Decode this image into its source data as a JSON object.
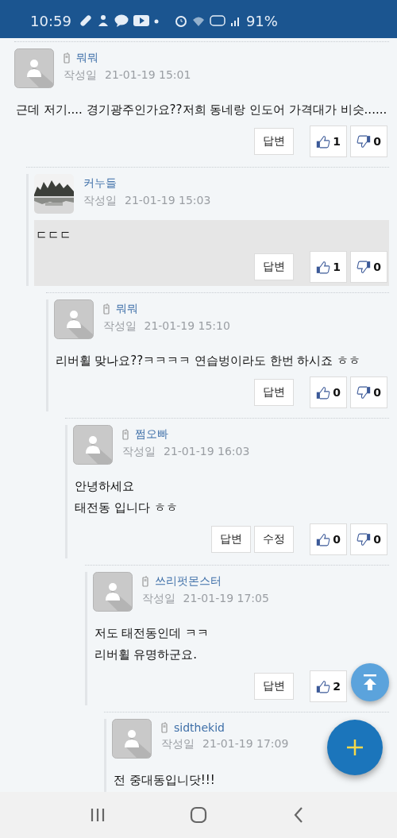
{
  "status_bar": {
    "time": "10:59",
    "battery": "91%"
  },
  "comments": [
    {
      "author": "뭐뭐",
      "mobile": true,
      "kind": "default",
      "date_label": "작성일",
      "date": "21-01-19 15:01",
      "body": [
        "근데 저기.... 경기광주인가요??저희 동네랑 인도어 가격대가 비슷......"
      ],
      "highlighted": false,
      "actions": [
        "답변"
      ],
      "likes": "1",
      "dislikes": "0",
      "children": [
        {
          "author": "커누들",
          "mobile": false,
          "date_label": "작성일",
          "date": "21-01-19 15:03",
          "body": [
            "ㄷㄷㄷ"
          ],
          "highlighted": true,
          "actions": [
            "답변"
          ],
          "likes": "1",
          "dislikes": "0",
          "children": [
            {
              "author": "뭐뭐",
              "mobile": true,
              "kind": "default",
              "date_label": "작성일",
              "date": "21-01-19 15:10",
              "body": [
                "리버휠 맞나요??ㅋㅋㅋㅋ 연습벙이라도 한번 하시죠 ㅎㅎ"
              ],
              "highlighted": false,
              "actions": [
                "답변"
              ],
              "likes": "0",
              "dislikes": "0",
              "children": [
                {
                  "author": "쩜오빠",
                  "mobile": true,
                  "kind": "default",
                  "date_label": "작성일",
                  "date": "21-01-19 16:03",
                  "body": [
                    "안녕하세요",
                    "태전동 입니다 ㅎㅎ"
                  ],
                  "highlighted": false,
                  "actions": [
                    "답변",
                    "수정"
                  ],
                  "likes": "0",
                  "dislikes": "0",
                  "children": [
                    {
                      "author": "쓰리펏몬스터",
                      "mobile": true,
                      "kind": "default",
                      "date_label": "작성일",
                      "date": "21-01-19 17:05",
                      "body": [
                        "저도 태전동인데 ㅋㅋ",
                        "리버휠 유명하군요."
                      ],
                      "highlighted": false,
                      "actions": [
                        "답변"
                      ],
                      "likes": "2",
                      "children": [
                        {
                          "author": "sidthekid",
                          "mobile": true,
                          "kind": "default",
                          "date_label": "작성일",
                          "date": "21-01-19 17:09",
                          "body": [
                            "전 중대동입니닷!!!"
                          ],
                          "highlighted": false
                        }
                      ]
                    }
                  ]
                }
              ]
            }
          ]
        }
      ]
    }
  ]
}
